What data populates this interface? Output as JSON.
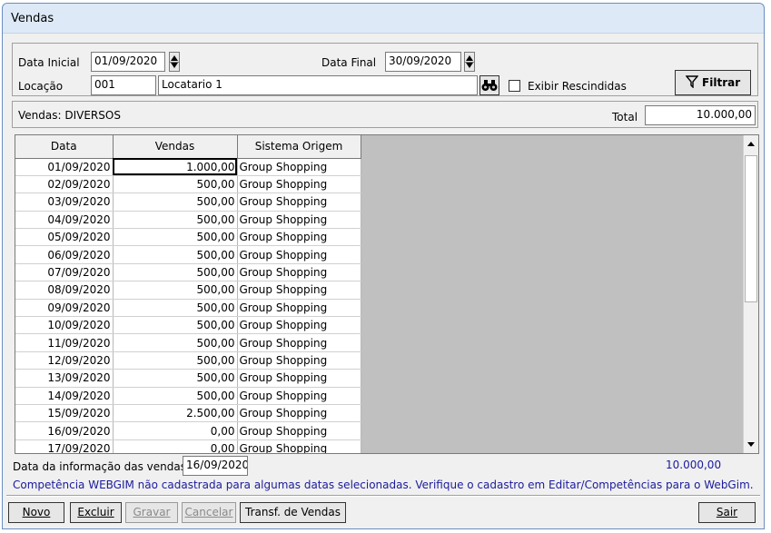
{
  "window": {
    "title": "Vendas"
  },
  "filters": {
    "data_inicial_label": "Data Inicial",
    "data_inicial_value": "01/09/2020",
    "data_final_label": "Data Final",
    "data_final_value": "30/09/2020",
    "locacao_label": "Locação",
    "locacao_code": "001",
    "locacao_name": "Locatario 1",
    "exibir_rescindidas_label": "Exibir Rescindidas",
    "exibir_rescindidas_checked": false,
    "filtrar_label": "Filtrar"
  },
  "summary": {
    "vendas_label": "Vendas: DIVERSOS",
    "total_label": "Total",
    "total_value": "10.000,00"
  },
  "grid": {
    "columns": [
      "Data",
      "Vendas",
      "Sistema Origem"
    ],
    "rows": [
      [
        "01/09/2020",
        "1.000,00",
        "Group Shopping"
      ],
      [
        "02/09/2020",
        "500,00",
        "Group Shopping"
      ],
      [
        "03/09/2020",
        "500,00",
        "Group Shopping"
      ],
      [
        "04/09/2020",
        "500,00",
        "Group Shopping"
      ],
      [
        "05/09/2020",
        "500,00",
        "Group Shopping"
      ],
      [
        "06/09/2020",
        "500,00",
        "Group Shopping"
      ],
      [
        "07/09/2020",
        "500,00",
        "Group Shopping"
      ],
      [
        "08/09/2020",
        "500,00",
        "Group Shopping"
      ],
      [
        "09/09/2020",
        "500,00",
        "Group Shopping"
      ],
      [
        "10/09/2020",
        "500,00",
        "Group Shopping"
      ],
      [
        "11/09/2020",
        "500,00",
        "Group Shopping"
      ],
      [
        "12/09/2020",
        "500,00",
        "Group Shopping"
      ],
      [
        "13/09/2020",
        "500,00",
        "Group Shopping"
      ],
      [
        "14/09/2020",
        "500,00",
        "Group Shopping"
      ],
      [
        "15/09/2020",
        "2.500,00",
        "Group Shopping"
      ],
      [
        "16/09/2020",
        "0,00",
        "Group Shopping"
      ],
      [
        "17/09/2020",
        "0,00",
        "Group Shopping"
      ]
    ]
  },
  "footer": {
    "data_info_label": "Data da informação das vendas",
    "data_info_value": "16/09/2020",
    "sum_value": "10.000,00",
    "warning": "Competência WEBGIM não cadastrada para algumas datas selecionadas. Verifique o cadastro em Editar/Competências para o WebGim."
  },
  "buttons": {
    "novo": "Novo",
    "excluir": "Excluir",
    "gravar": "Gravar",
    "cancelar": "Cancelar",
    "transf": "Transf. de Vendas",
    "sair": "Sair"
  },
  "icons": {
    "spinner": "spinner-updown-icon",
    "search": "binoculars-icon",
    "filter": "funnel-icon"
  },
  "colors": {
    "titlebar": "#dde9f6",
    "warning_text": "#1b1b9e",
    "grid_empty": "#c0c0c0"
  }
}
